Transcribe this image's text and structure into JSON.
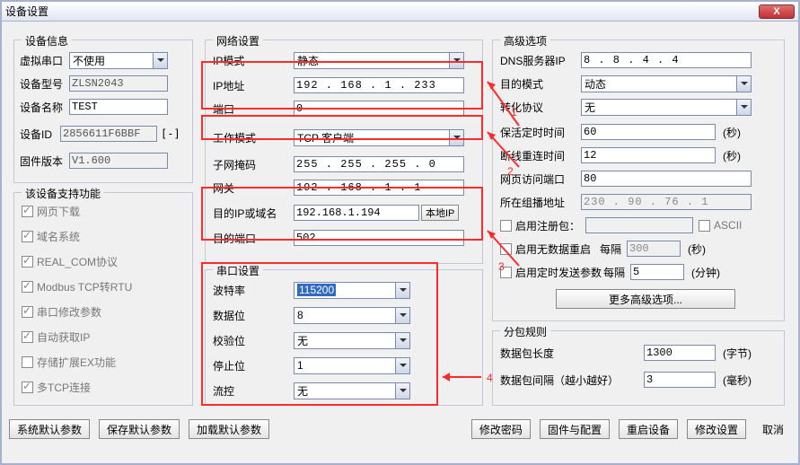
{
  "window": {
    "title": "设备设置",
    "close": "X"
  },
  "device_info": {
    "legend": "设备信息",
    "virtual_port_label": "虚拟串口",
    "virtual_port_value": "不使用",
    "model_label": "设备型号",
    "model_value": "ZLSN2043",
    "name_label": "设备名称",
    "name_value": "TEST",
    "id_label": "设备ID",
    "id_value": "2856611F6BBF",
    "id_collapse": "[-]",
    "fw_label": "固件版本",
    "fw_value": "V1.600"
  },
  "features": {
    "legend": "该设备支持功能",
    "items": [
      "网页下载",
      "域名系统",
      "REAL_COM协议",
      "Modbus TCP转RTU",
      "串口修改参数",
      "自动获取IP",
      "存储扩展EX功能",
      "多TCP连接"
    ]
  },
  "network": {
    "legend": "网络设置",
    "ip_mode_label": "IP模式",
    "ip_mode_value": "静态",
    "ip_addr_label": "IP地址",
    "ip_addr_value": "192 . 168 .  1  . 233",
    "port_label": "端口",
    "port_value": "0",
    "work_mode_label": "工作模式",
    "work_mode_value": "TCP 客户端",
    "mask_label": "子网掩码",
    "mask_value": "255 . 255 . 255 .  0",
    "gw_label": "网关",
    "gw_value": "192 . 168 .  1  .  1",
    "dest_ip_label": "目的IP或域名",
    "dest_ip_value": "192.168.1.194",
    "local_ip_btn": "本地IP",
    "dest_port_label": "目的端口",
    "dest_port_value": "502"
  },
  "serial": {
    "legend": "串口设置",
    "baud_label": "波特率",
    "baud_value": "115200",
    "databit_label": "数据位",
    "databit_value": "8",
    "parity_label": "校验位",
    "parity_value": "无",
    "stopbit_label": "停止位",
    "stopbit_value": "1",
    "flow_label": "流控",
    "flow_value": "无"
  },
  "advanced": {
    "legend": "高级选项",
    "dns_label": "DNS服务器IP",
    "dns_value": " 8  .  8  .  4  .  4",
    "dest_mode_label": "目的模式",
    "dest_mode_value": "动态",
    "proto_label": "转化协议",
    "proto_value": "无",
    "keepalive_label": "保活定时时间",
    "keepalive_value": "60",
    "sec": "(秒)",
    "reconnect_label": "断线重连时间",
    "reconnect_value": "12",
    "webport_label": "网页访问端口",
    "webport_value": "80",
    "multicast_label": "所在组播地址",
    "multicast_value": "230 .  90 .  76 .  1",
    "reg_pkt_label": "启用注册包：",
    "ascii_label": "ASCII",
    "nodata_label": "启用无数据重启",
    "every": "每隔",
    "nodata_value": "300",
    "timed_label": "启用定时发送参数",
    "timed_value": "5",
    "min": "(分钟)",
    "more_btn": "更多高级选项..."
  },
  "packet": {
    "legend": "分包规则",
    "len_label": "数据包长度",
    "len_value": "1300",
    "byte": "(字节)",
    "gap_label": "数据包间隔（越小越好）",
    "gap_value": "3",
    "ms": "(毫秒)"
  },
  "buttons": {
    "sys_default": "系统默认参数",
    "save_default": "保存默认参数",
    "load_default": "加载默认参数",
    "change_pwd": "修改密码",
    "fw_cfg": "固件与配置",
    "restart": "重启设备",
    "apply": "修改设置",
    "cancel": "取消"
  },
  "annotations": {
    "a1": "1",
    "a2": "2",
    "a3": "3",
    "a4": "4"
  }
}
